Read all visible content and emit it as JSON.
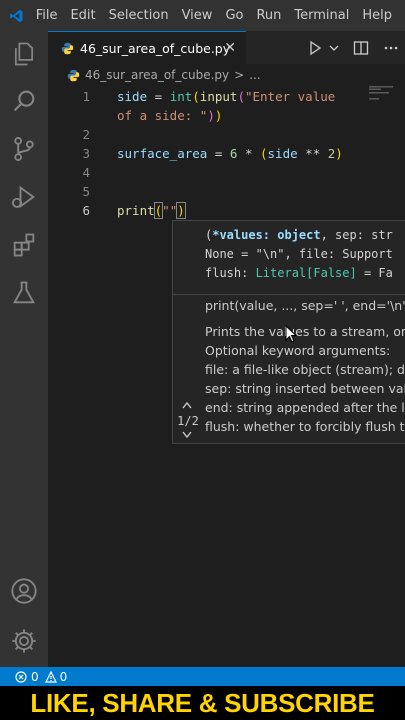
{
  "menu": [
    "File",
    "Edit",
    "Selection",
    "View",
    "Go",
    "Run",
    "Terminal",
    "Help"
  ],
  "tab": {
    "filename": "46_sur_area_of_cube.py",
    "close": "✕"
  },
  "breadcrumb": {
    "file": "46_sur_area_of_cube.py",
    "sep": ">",
    "rest": "..."
  },
  "line_numbers": [
    "1",
    "",
    "2",
    "3",
    "4",
    "5",
    "6"
  ],
  "code": {
    "l1a": {
      "var": "side",
      "eq": " = ",
      "int": "int",
      "p1": "(",
      "input": "input",
      "p2": "(",
      "str": "\"Enter value"
    },
    "l1b": {
      "str": "of a side: \"",
      "p2": ")",
      "p1": ")"
    },
    "l3": {
      "var": "surface_area",
      "eq": " = ",
      "num1": "6",
      "op": " * ",
      "p": "(",
      "var2": "side",
      "pow": " ** ",
      "num2": "2",
      "pc": ")"
    },
    "l6": {
      "fn": "print",
      "p": "(",
      "str": "\"\"",
      "pc": ")"
    }
  },
  "hover": {
    "sig1": {
      "open": "(",
      "name": "*values: object",
      "rest": ", sep: str"
    },
    "sig2": "None = \"\\n\", file: Support",
    "sig3": {
      "a": "flush: ",
      "ty": "Literal[False]",
      "b": " = Fa"
    },
    "doc": [
      "print(value, ..., sep=' ', end='\\n', f",
      "Prints the values to a stream, or t",
      "Optional keyword arguments:",
      "file: a file-like object (stream); de",
      "sep: string inserted between valu",
      "end: string appended after the la",
      "flush: whether to forcibly flush th"
    ],
    "pager": "1/2"
  },
  "status": {
    "errors": "0",
    "warnings": "0"
  },
  "banner": "LIKE, SHARE & SUBSCRIBE",
  "colors": {
    "accent": "#007acc",
    "banner_text": "#ffd400"
  },
  "icons": [
    "vscode-logo-icon",
    "explorer-icon",
    "search-icon",
    "source-control-icon",
    "run-debug-icon",
    "extensions-icon",
    "testing-icon",
    "account-icon",
    "settings-gear-icon",
    "python-file-icon",
    "run-icon",
    "split-editor-icon",
    "more-icon",
    "error-icon",
    "warning-icon"
  ]
}
